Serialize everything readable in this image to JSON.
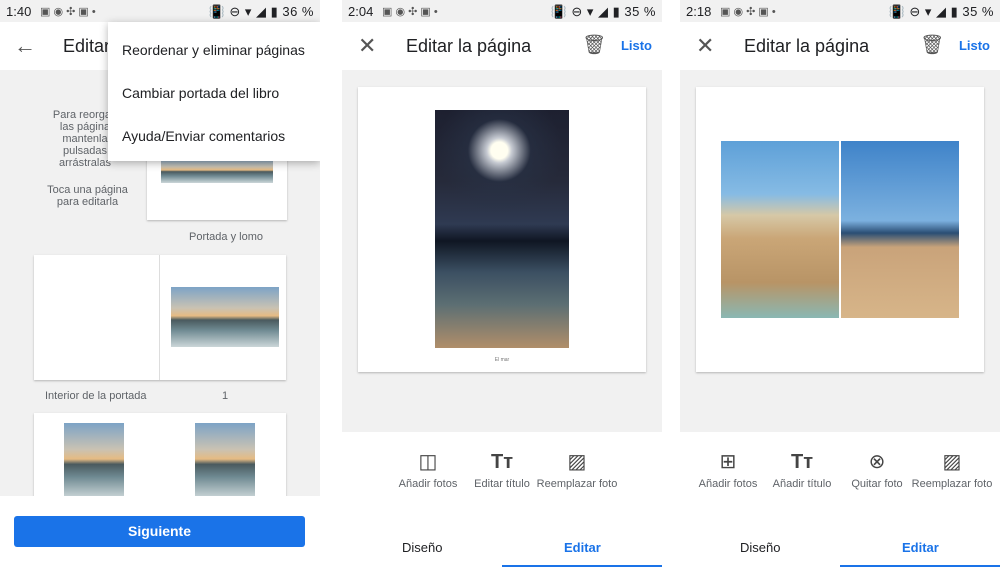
{
  "screen1": {
    "status": {
      "time": "1:40",
      "battery": "36 %"
    },
    "title": "Editar",
    "menu": [
      "Reordenar y eliminar páginas",
      "Cambiar portada del libro",
      "Ayuda/Enviar comentarios"
    ],
    "side_hint1": [
      "Para reorgan",
      "las página",
      "mantenla",
      "pulsadas",
      "arrástralas"
    ],
    "side_hint2": [
      "Toca una página",
      "para editarla"
    ],
    "cover_caption": "Portada y lomo",
    "inner_caption": "Interior de la portada",
    "page_number": "1",
    "next_button": "Siguiente"
  },
  "screen2": {
    "status": {
      "time": "2:04",
      "battery": "35 %"
    },
    "title": "Editar la página",
    "done": "Listo",
    "photo_caption": "El mar",
    "tools": [
      "Añadir fotos",
      "Editar título",
      "Reemplazar foto"
    ],
    "tabs": [
      "Diseño",
      "Editar"
    ]
  },
  "screen3": {
    "status": {
      "time": "2:18",
      "battery": "35 %"
    },
    "title": "Editar la página",
    "done": "Listo",
    "tools": [
      "Añadir fotos",
      "Añadir título",
      "Quitar foto",
      "Reemplazar foto"
    ],
    "tabs": [
      "Diseño",
      "Editar"
    ]
  },
  "colors": {
    "accent": "#1a73e8"
  },
  "icons": [
    "back-arrow-icon",
    "close-icon",
    "delete-icon",
    "add-photo-icon",
    "title-icon",
    "replace-photo-icon",
    "remove-photo-icon",
    "layout-icon"
  ]
}
